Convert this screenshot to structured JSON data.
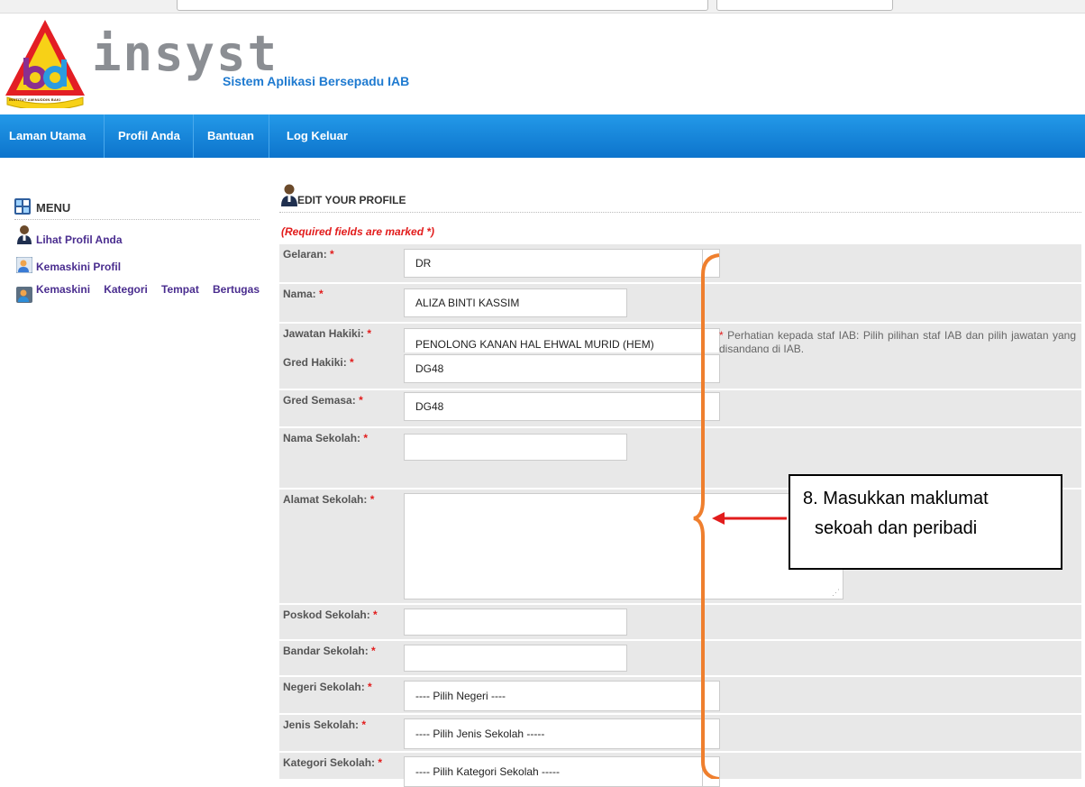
{
  "header": {
    "brand_text": "insyst",
    "subtitle": "Sistem Aplikasi Bersepadu IAB",
    "logo_ring_text": "INSTITUT AMINUDDIN BAKI"
  },
  "nav": {
    "items": [
      "Laman Utama",
      "Profil Anda",
      "Bantuan",
      "Log Keluar"
    ]
  },
  "sidebar": {
    "title": "MENU",
    "icons": [
      "menu-grid-icon",
      "user-icon",
      "user-edit-icon",
      "user-category-icon"
    ],
    "links": [
      "Lihat Profil Anda",
      "Kemaskini Profil",
      "Kemaskini Kategori Tempat Bertugas"
    ]
  },
  "main": {
    "title": "EDIT YOUR PROFILE",
    "required_note": "(Required fields are marked *)",
    "fields": [
      {
        "label": "Gelaran:",
        "value": "DR"
      },
      {
        "label": "Nama:",
        "value": "ALIZA BINTI KASSIM"
      },
      {
        "label": "Jawatan Hakiki:",
        "value": "PENOLONG KANAN HAL EHWAL MURID (HEM)",
        "note": "Perhatian kepada staf IAB: Pilih pilihan staf IAB dan pilih jawatan yang disandang di IAB."
      },
      {
        "label": "Gred Hakiki:",
        "value": "DG48"
      },
      {
        "label": "Gred Semasa:",
        "value": "DG48"
      },
      {
        "label": "Nama Sekolah:",
        "value": ""
      },
      {
        "label": "Alamat Sekolah:",
        "value": ""
      },
      {
        "label": "Poskod Sekolah:",
        "value": ""
      },
      {
        "label": "Bandar Sekolah:",
        "value": ""
      },
      {
        "label": "Negeri Sekolah:",
        "value": "---- Pilih Negeri ----"
      },
      {
        "label": "Jenis Sekolah:",
        "value": "---- Pilih Jenis Sekolah -----"
      },
      {
        "label": "Kategori Sekolah:",
        "value": "---- Pilih Kategori Sekolah -----"
      }
    ],
    "required_marker": "*"
  },
  "annotation": {
    "line1": "8. Masukkan maklumat",
    "line2": "sekoah dan peribadi",
    "colors": {
      "brace": "#ef7f2e",
      "arrow": "#e21c1c"
    }
  },
  "colors": {
    "nav": "#1a87dc",
    "link": "#4a2d8f",
    "required": "#e21c1c",
    "subtitle": "#1e7ad0"
  }
}
